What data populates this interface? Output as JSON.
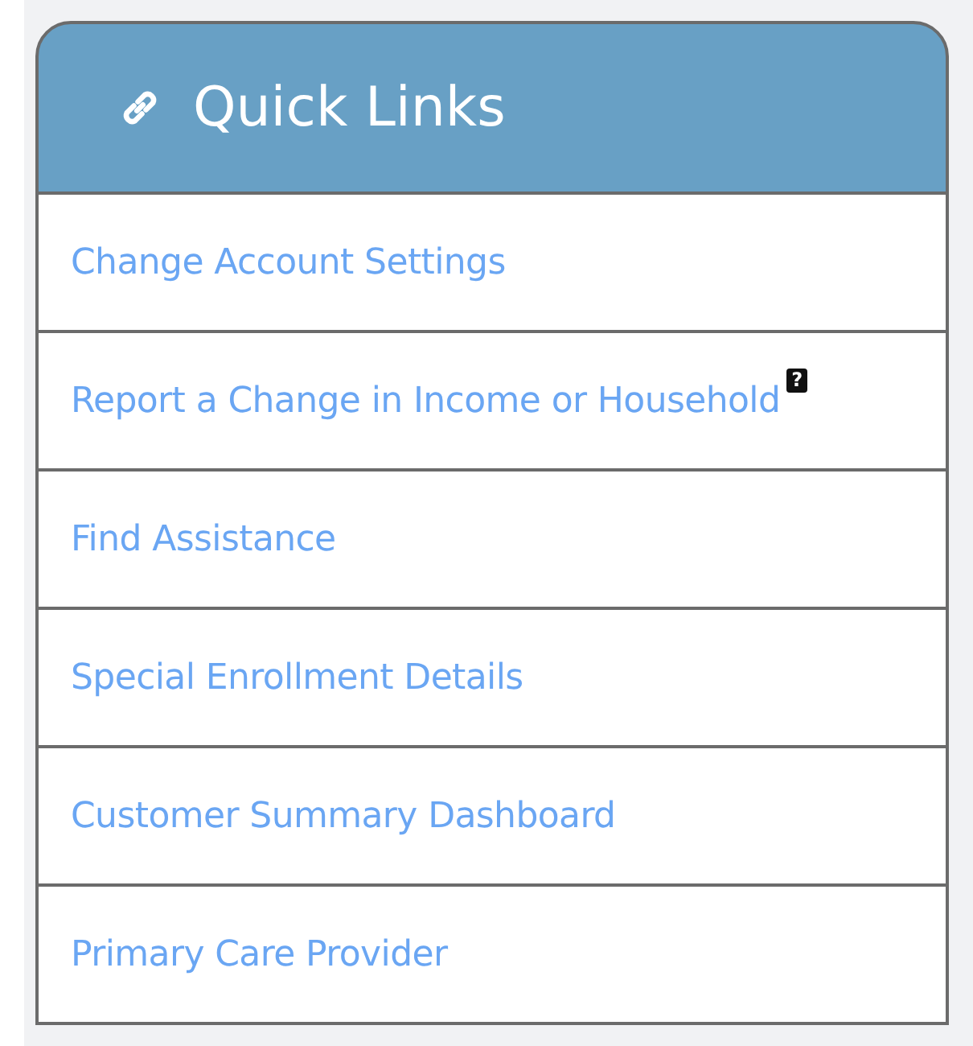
{
  "panel": {
    "title": "Quick Links"
  },
  "links": [
    {
      "label": "Change Account Settings"
    },
    {
      "label": "Report a Change in Income or Household",
      "help_badge": "?"
    },
    {
      "label": "Find Assistance"
    },
    {
      "label": "Special Enrollment Details"
    },
    {
      "label": "Customer Summary Dashboard"
    },
    {
      "label": "Primary Care Provider"
    }
  ]
}
